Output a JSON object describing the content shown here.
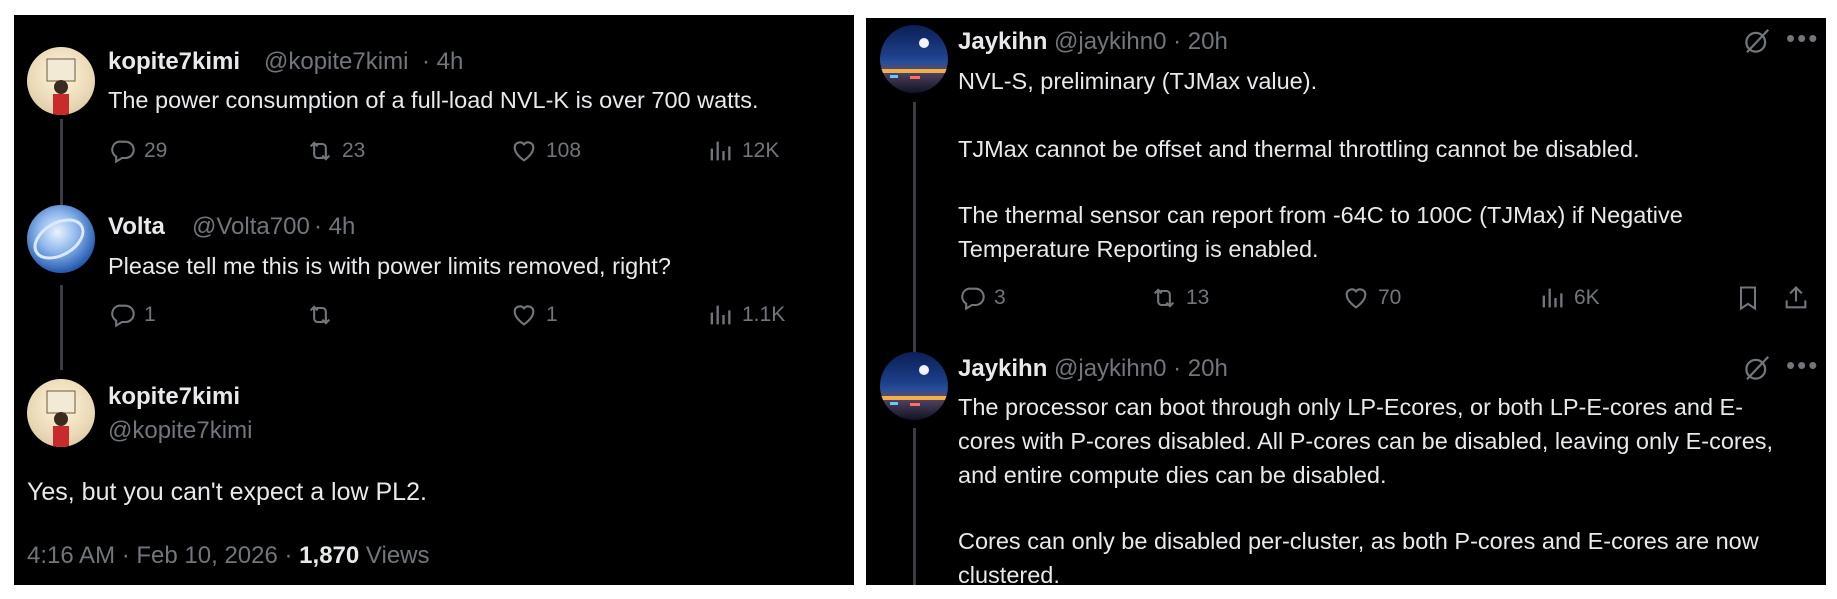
{
  "left": {
    "tweet1": {
      "name": "kopite7kimi",
      "handle": "@kopite7kimi",
      "time": "· 4h",
      "text": "The power consumption of a full-load NVL-K is over 700 watts.",
      "replies": "29",
      "retweets": "23",
      "likes": "108",
      "views": "12K"
    },
    "tweet2": {
      "name": "Volta",
      "handle": "@Volta700",
      "time": "· 4h",
      "text": "Please tell me this is with power limits removed, right?",
      "replies": "1",
      "retweets": "",
      "likes": "1",
      "views": "1.1K"
    },
    "tweet3": {
      "name": "kopite7kimi",
      "handle": "@kopite7kimi",
      "text": "Yes, but you can't expect a low PL2.",
      "timestamp": "4:16 AM · Feb 10, 2026 ·",
      "views_count": "1,870",
      "views_label": "Views"
    }
  },
  "right": {
    "tweet1": {
      "name": "Jaykihn",
      "handle": "@jaykihn0 · 20h",
      "lines": [
        "NVL-S, preliminary (TJMax value).",
        "TJMax cannot be offset and thermal throttling cannot be disabled.",
        "The thermal sensor can report from -64C to 100C (TJMax) if Negative",
        "Temperature Reporting is enabled."
      ],
      "replies": "3",
      "retweets": "13",
      "likes": "70",
      "views": "6K"
    },
    "tweet2": {
      "name": "Jaykihn",
      "handle": "@jaykihn0 · 20h",
      "lines": [
        "The processor can boot through only LP-Ecores, or both LP-E-cores and E-",
        "cores with P-cores disabled. All P-cores can be disabled, leaving only E-cores,",
        "and entire compute dies can be disabled.",
        "Cores can only be disabled per-cluster, as both P-cores and E-cores are now",
        "clustered."
      ]
    }
  },
  "icons": [
    "reply-icon",
    "retweet-icon",
    "like-icon",
    "views-icon",
    "bookmark-icon",
    "share-icon",
    "grok-icon",
    "more-icon"
  ]
}
